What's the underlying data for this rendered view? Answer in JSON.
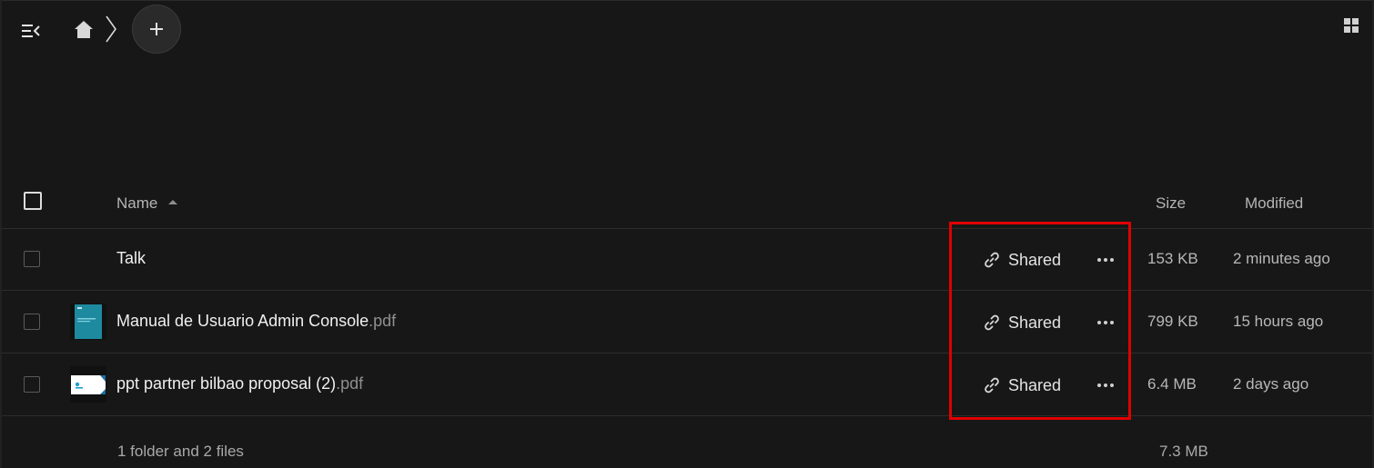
{
  "header": {
    "menu_icon": "menu-collapse-icon",
    "home_icon": "home-icon",
    "separator_icon": "chevron-right-icon",
    "new_icon": "plus-icon",
    "view_icon": "grid-view-icon"
  },
  "table": {
    "columns": {
      "name": "Name",
      "size": "Size",
      "modified": "Modified"
    },
    "rows": [
      {
        "name": "Talk",
        "ext": "",
        "type": "folder",
        "share_label": "Shared",
        "size": "153 KB",
        "modified": "2 minutes ago"
      },
      {
        "name": "Manual de Usuario Admin Console",
        "ext": ".pdf",
        "type": "pdf",
        "share_label": "Shared",
        "size": "799 KB",
        "modified": "15 hours ago"
      },
      {
        "name": "ppt partner bilbao proposal (2)",
        "ext": ".pdf",
        "type": "pdf",
        "share_label": "Shared",
        "size": "6.4 MB",
        "modified": "2 days ago"
      }
    ],
    "summary": {
      "text": "1 folder and 2 files",
      "size": "7.3 MB"
    }
  },
  "colors": {
    "background": "#171717",
    "highlight": "#e00000",
    "thumb_teal": "#1e8aa0"
  }
}
